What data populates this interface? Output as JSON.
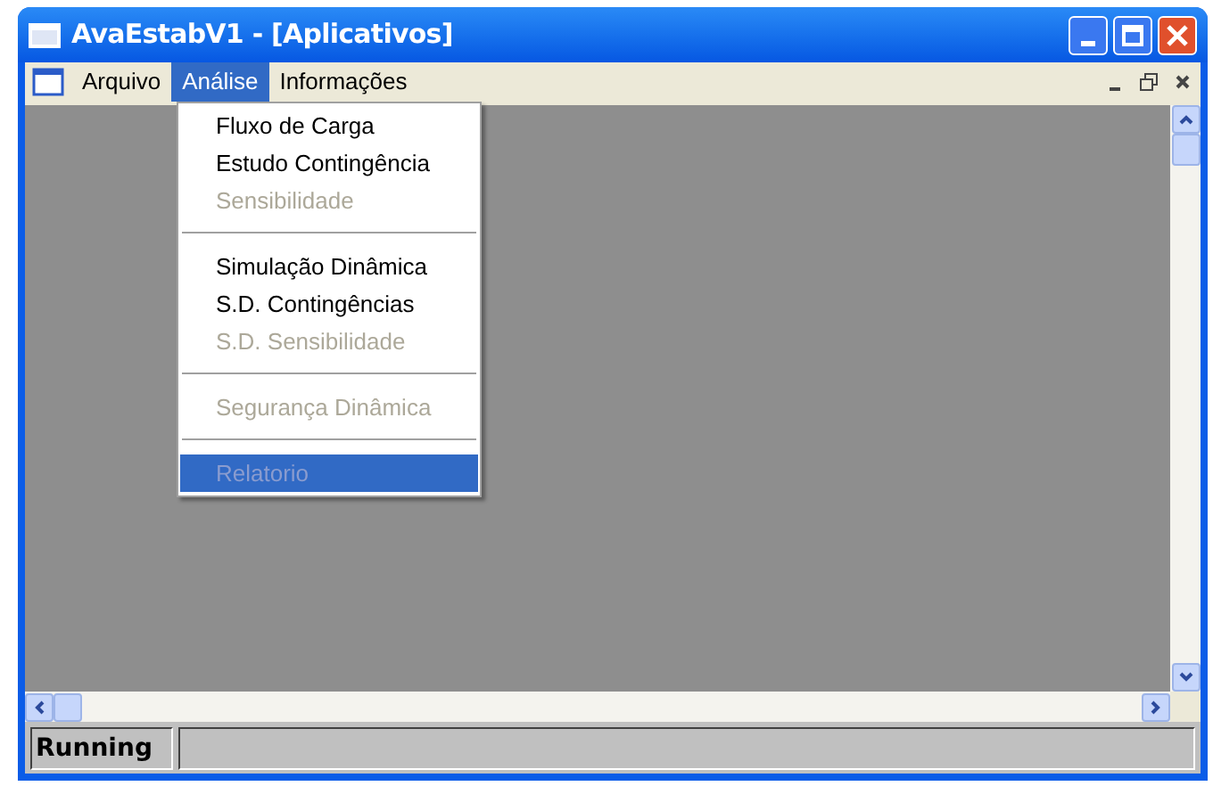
{
  "window": {
    "title": "AvaEstabV1 - [Aplicativos]"
  },
  "menu_bar": [
    {
      "label": "Arquivo",
      "selected": false
    },
    {
      "label": "Análise",
      "selected": true
    },
    {
      "label": "Informações",
      "selected": false
    }
  ],
  "dropdown": [
    {
      "kind": "item",
      "label": "Fluxo de Carga",
      "disabled": false,
      "selected": false
    },
    {
      "kind": "item",
      "label": "Estudo Contingência",
      "disabled": false,
      "selected": false
    },
    {
      "kind": "item",
      "label": "Sensibilidade",
      "disabled": true,
      "selected": false
    },
    {
      "kind": "separator"
    },
    {
      "kind": "item",
      "label": "Simulação Dinâmica",
      "disabled": false,
      "selected": false
    },
    {
      "kind": "item",
      "label": "S.D. Contingências",
      "disabled": false,
      "selected": false
    },
    {
      "kind": "item",
      "label": "S.D. Sensibilidade",
      "disabled": true,
      "selected": false
    },
    {
      "kind": "separator"
    },
    {
      "kind": "item",
      "label": "Segurança Dinâmica",
      "disabled": true,
      "selected": false
    },
    {
      "kind": "separator"
    },
    {
      "kind": "item",
      "label": "Relatorio",
      "disabled": true,
      "selected": true
    }
  ],
  "status_bar": {
    "text": "Running"
  }
}
